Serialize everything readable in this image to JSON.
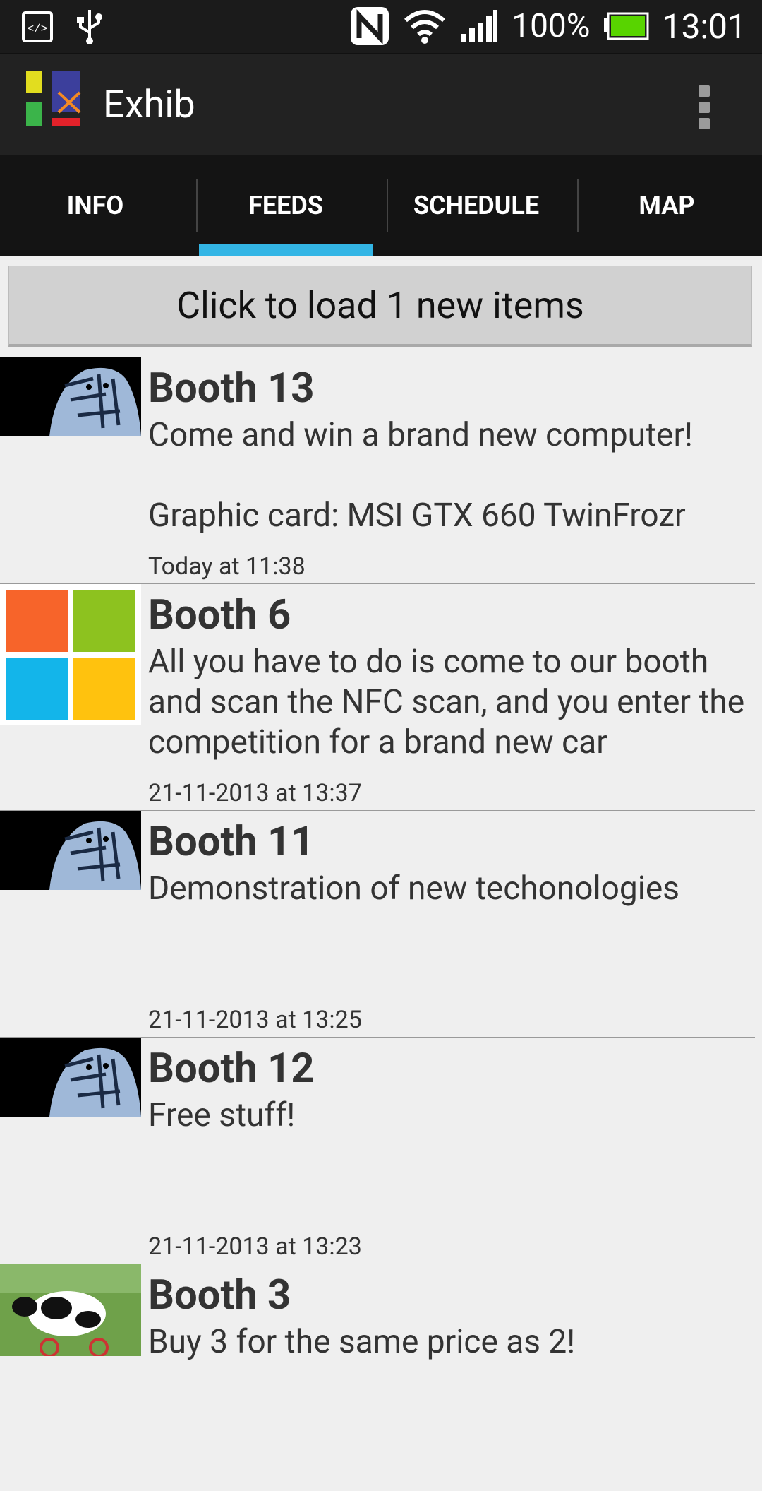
{
  "status_bar": {
    "battery_percent": "100%",
    "time": "13:01",
    "icons": [
      "developer-icon",
      "usb-icon",
      "nfc-icon",
      "wifi-icon",
      "signal-icon",
      "battery-icon"
    ],
    "battery_color": "#58d400"
  },
  "app": {
    "title": "Exhib",
    "accent": "#33b5e5"
  },
  "tabs": [
    {
      "label": "INFO",
      "active": false
    },
    {
      "label": "FEEDS",
      "active": true
    },
    {
      "label": "SCHEDULE",
      "active": false
    },
    {
      "label": "MAP",
      "active": false
    }
  ],
  "load_button": {
    "label": "Click to load 1 new items"
  },
  "feed": [
    {
      "booth": "Booth 13",
      "message": "Come and win a brand new computer!\n\nGraphic card: MSI GTX 660 TwinFrozr",
      "time": "Today at 11:38",
      "thumb": "tiger"
    },
    {
      "booth": "Booth 6",
      "message": "All you have to do is come to our booth and scan the NFC scan, and you enter the competition for a brand new car",
      "time": "21-11-2013 at 13:37",
      "thumb": "windows"
    },
    {
      "booth": "Booth 11",
      "message": "Demonstration of new techonologies",
      "time": "21-11-2013 at 13:25",
      "thumb": "tiger"
    },
    {
      "booth": "Booth 12",
      "message": "Free stuff!",
      "time": "21-11-2013 at 13:23",
      "thumb": "tiger"
    },
    {
      "booth": "Booth 3",
      "message": "Buy 3 for the same price as 2!",
      "time": "",
      "thumb": "cow"
    }
  ]
}
